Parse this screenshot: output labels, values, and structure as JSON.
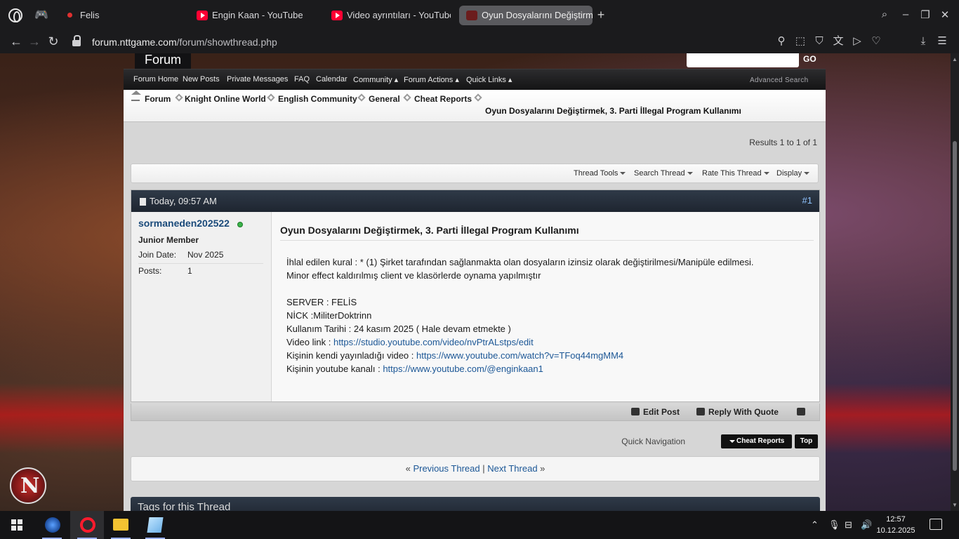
{
  "browser": {
    "tabs": [
      {
        "title": "Felis"
      },
      {
        "title": "Engin Kaan - YouTube"
      },
      {
        "title": "Video ayrıntıları - YouTube"
      },
      {
        "title": "Oyun Dosyalarını Değiştirmek"
      }
    ],
    "url_domain": "forum.nttgame.com",
    "url_path": "/forum/showthread.php"
  },
  "forum": {
    "tab_label": "Forum",
    "go_label": "GO",
    "nav": [
      "Forum Home",
      "New Posts",
      "Private Messages",
      "FAQ",
      "Calendar",
      "Community",
      "Forum Actions",
      "Quick Links"
    ],
    "advanced_search": "Advanced Search",
    "breadcrumbs": [
      "Forum",
      "Knight Online World",
      "English Community",
      "General",
      "Cheat Reports"
    ],
    "thread_title": "Oyun Dosyalarını Değiştirmek, 3. Parti İllegal Program Kullanımı",
    "results": "Results 1 to 1 of 1",
    "tools": [
      "Thread Tools",
      "Search Thread",
      "Rate This Thread",
      "Display"
    ]
  },
  "post": {
    "date": "Today, 09:57 AM",
    "number": "#1",
    "username": "sormaneden202522",
    "user_title": "Junior Member",
    "join_label": "Join Date:",
    "join_value": "Nov 2025",
    "posts_label": "Posts:",
    "posts_value": "1",
    "title": "Oyun Dosyalarını Değiştirmek, 3. Parti İllegal Program Kullanımı",
    "lines": {
      "l1": "İhlal edilen kural : * (1) Şirket tarafından sağlanmakta olan dosyaların izinsiz olarak değiştirilmesi/Manipüle edilmesi.",
      "l2": "Minor effect kaldırılmış client ve klasörlerde oynama yapılmıştır",
      "l3": "SERVER : FELİS",
      "l4": "NİCK :MiliterDoktrinn",
      "l5": "Kullanım Tarihi : 24 kasım 2025 ( Hale devam etmekte )",
      "l6_label": "Video link : ",
      "l6_link": "https://studio.youtube.com/video/nvPtrALstps/edit",
      "l7_label": "Kişinin kendi yayınladığı video : ",
      "l7_link": "https://www.youtube.com/watch?v=TFoq44mgMM4",
      "l8_label": "Kişinin youtube kanalı : ",
      "l8_link": "https://www.youtube.com/@enginkaan1"
    },
    "edit_label": "Edit Post",
    "reply_quote_label": "Reply With Quote"
  },
  "quicknav": {
    "label": "Quick Navigation",
    "selected": "Cheat Reports",
    "top_label": "Top"
  },
  "threadnav": {
    "prev": "Previous Thread",
    "sep": "|",
    "next": "Next Thread"
  },
  "tags_title": "Tags for this Thread",
  "clock": {
    "time": "12:57",
    "date": "10.12.2025"
  }
}
